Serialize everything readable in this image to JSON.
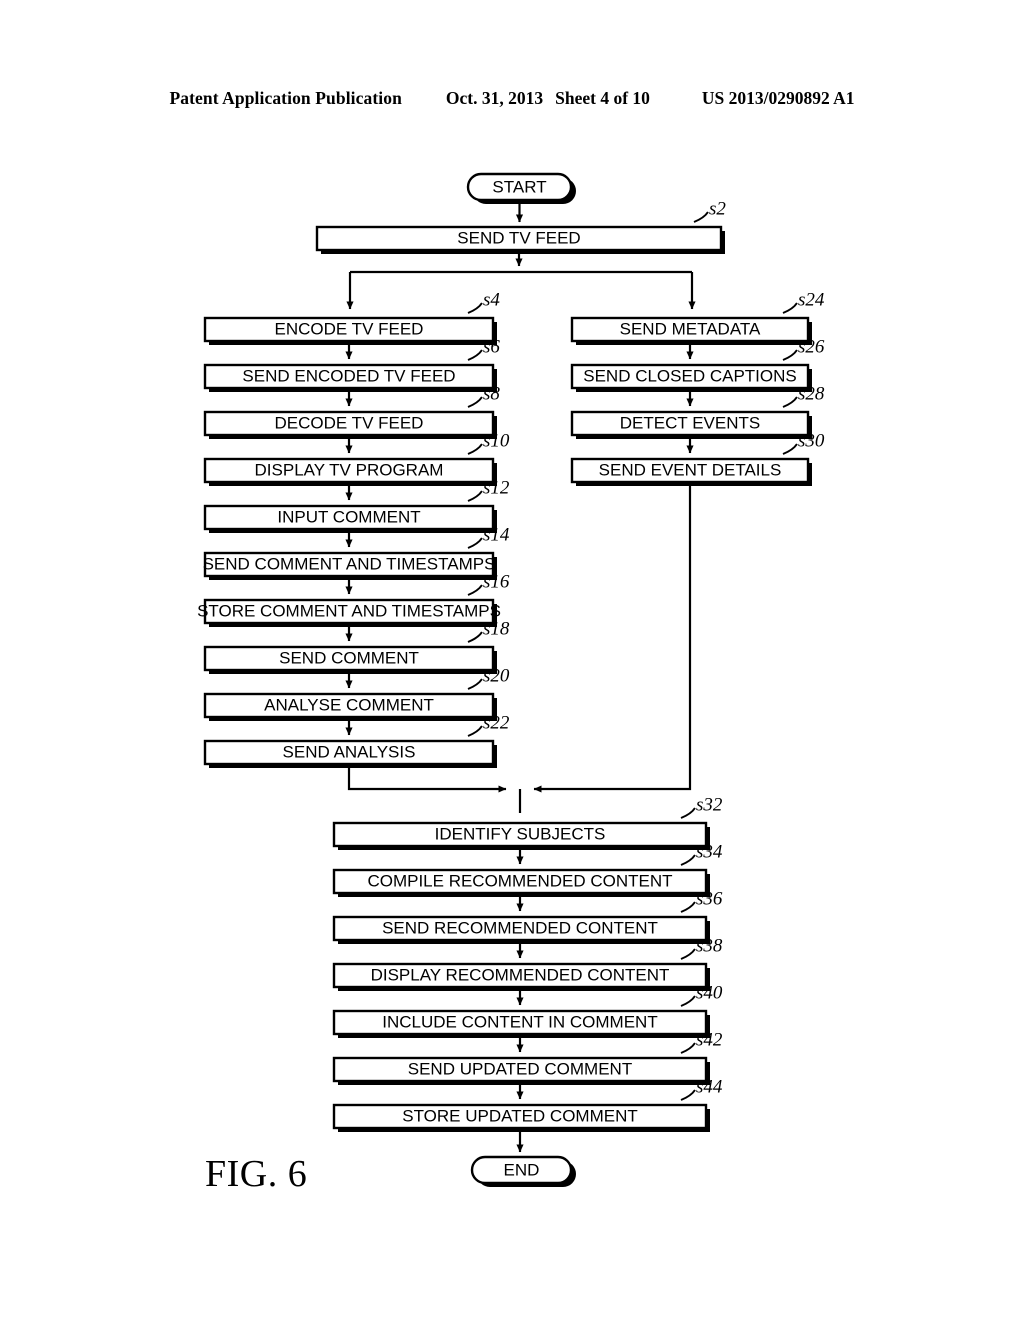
{
  "header": {
    "publication": "Patent Application Publication",
    "date": "Oct. 31, 2013",
    "sheet": "Sheet 4 of 10",
    "pub_number": "US 2013/0290892 A1"
  },
  "figure": {
    "caption": "FIG. 6",
    "start_label": "START",
    "end_label": "END"
  },
  "chart_data": {
    "type": "diagram",
    "title": "FIG. 6",
    "diagram_kind": "flowchart",
    "nodes": [
      {
        "id": "start",
        "label": "START",
        "shape": "terminator",
        "ref": ""
      },
      {
        "id": "s2",
        "label": "SEND TV FEED",
        "shape": "process",
        "ref": "s2",
        "column": "full"
      },
      {
        "id": "s4",
        "label": "ENCODE TV FEED",
        "shape": "process",
        "ref": "s4",
        "column": "left"
      },
      {
        "id": "s6",
        "label": "SEND ENCODED TV FEED",
        "shape": "process",
        "ref": "s6",
        "column": "left"
      },
      {
        "id": "s8",
        "label": "DECODE TV FEED",
        "shape": "process",
        "ref": "s8",
        "column": "left"
      },
      {
        "id": "s10",
        "label": "DISPLAY TV PROGRAM",
        "shape": "process",
        "ref": "s10",
        "column": "left"
      },
      {
        "id": "s12",
        "label": "INPUT COMMENT",
        "shape": "process",
        "ref": "s12",
        "column": "left"
      },
      {
        "id": "s14",
        "label": "SEND COMMENT AND TIMESTAMPS",
        "shape": "process",
        "ref": "s14",
        "column": "left"
      },
      {
        "id": "s16",
        "label": "STORE COMMENT AND TIMESTAMPS",
        "shape": "process",
        "ref": "s16",
        "column": "left"
      },
      {
        "id": "s18",
        "label": "SEND COMMENT",
        "shape": "process",
        "ref": "s18",
        "column": "left"
      },
      {
        "id": "s20",
        "label": "ANALYSE COMMENT",
        "shape": "process",
        "ref": "s20",
        "column": "left"
      },
      {
        "id": "s22",
        "label": "SEND ANALYSIS",
        "shape": "process",
        "ref": "s22",
        "column": "left"
      },
      {
        "id": "s24",
        "label": "SEND METADATA",
        "shape": "process",
        "ref": "s24",
        "column": "right"
      },
      {
        "id": "s26",
        "label": "SEND CLOSED CAPTIONS",
        "shape": "process",
        "ref": "s26",
        "column": "right"
      },
      {
        "id": "s28",
        "label": "DETECT EVENTS",
        "shape": "process",
        "ref": "s28",
        "column": "right"
      },
      {
        "id": "s30",
        "label": "SEND EVENT DETAILS",
        "shape": "process",
        "ref": "s30",
        "column": "right"
      },
      {
        "id": "s32",
        "label": "IDENTIFY SUBJECTS",
        "shape": "process",
        "ref": "s32",
        "column": "center"
      },
      {
        "id": "s34",
        "label": "COMPILE RECOMMENDED CONTENT",
        "shape": "process",
        "ref": "s34",
        "column": "center"
      },
      {
        "id": "s36",
        "label": "SEND RECOMMENDED CONTENT",
        "shape": "process",
        "ref": "s36",
        "column": "center"
      },
      {
        "id": "s38",
        "label": "DISPLAY RECOMMENDED CONTENT",
        "shape": "process",
        "ref": "s38",
        "column": "center"
      },
      {
        "id": "s40",
        "label": "INCLUDE CONTENT IN COMMENT",
        "shape": "process",
        "ref": "s40",
        "column": "center"
      },
      {
        "id": "s42",
        "label": "SEND UPDATED COMMENT",
        "shape": "process",
        "ref": "s42",
        "column": "center"
      },
      {
        "id": "s44",
        "label": "STORE UPDATED COMMENT",
        "shape": "process",
        "ref": "s44",
        "column": "center"
      },
      {
        "id": "end",
        "label": "END",
        "shape": "terminator",
        "ref": ""
      }
    ],
    "edges": [
      {
        "from": "start",
        "to": "s2"
      },
      {
        "from": "s2",
        "to": "s4",
        "note": "branch-left"
      },
      {
        "from": "s2",
        "to": "s24",
        "note": "branch-right"
      },
      {
        "from": "s4",
        "to": "s6"
      },
      {
        "from": "s6",
        "to": "s8"
      },
      {
        "from": "s8",
        "to": "s10"
      },
      {
        "from": "s10",
        "to": "s12"
      },
      {
        "from": "s12",
        "to": "s14"
      },
      {
        "from": "s14",
        "to": "s16"
      },
      {
        "from": "s16",
        "to": "s18"
      },
      {
        "from": "s18",
        "to": "s20"
      },
      {
        "from": "s20",
        "to": "s22"
      },
      {
        "from": "s24",
        "to": "s26"
      },
      {
        "from": "s26",
        "to": "s28"
      },
      {
        "from": "s28",
        "to": "s30"
      },
      {
        "from": "s22",
        "to": "s32",
        "note": "merge-from-left"
      },
      {
        "from": "s30",
        "to": "s32",
        "note": "merge-from-right"
      },
      {
        "from": "s32",
        "to": "s34"
      },
      {
        "from": "s34",
        "to": "s36"
      },
      {
        "from": "s36",
        "to": "s38"
      },
      {
        "from": "s38",
        "to": "s40"
      },
      {
        "from": "s40",
        "to": "s42"
      },
      {
        "from": "s42",
        "to": "s44"
      },
      {
        "from": "s44",
        "to": "end"
      }
    ]
  },
  "colors": {
    "ink": "#000000",
    "paper": "#ffffff"
  }
}
